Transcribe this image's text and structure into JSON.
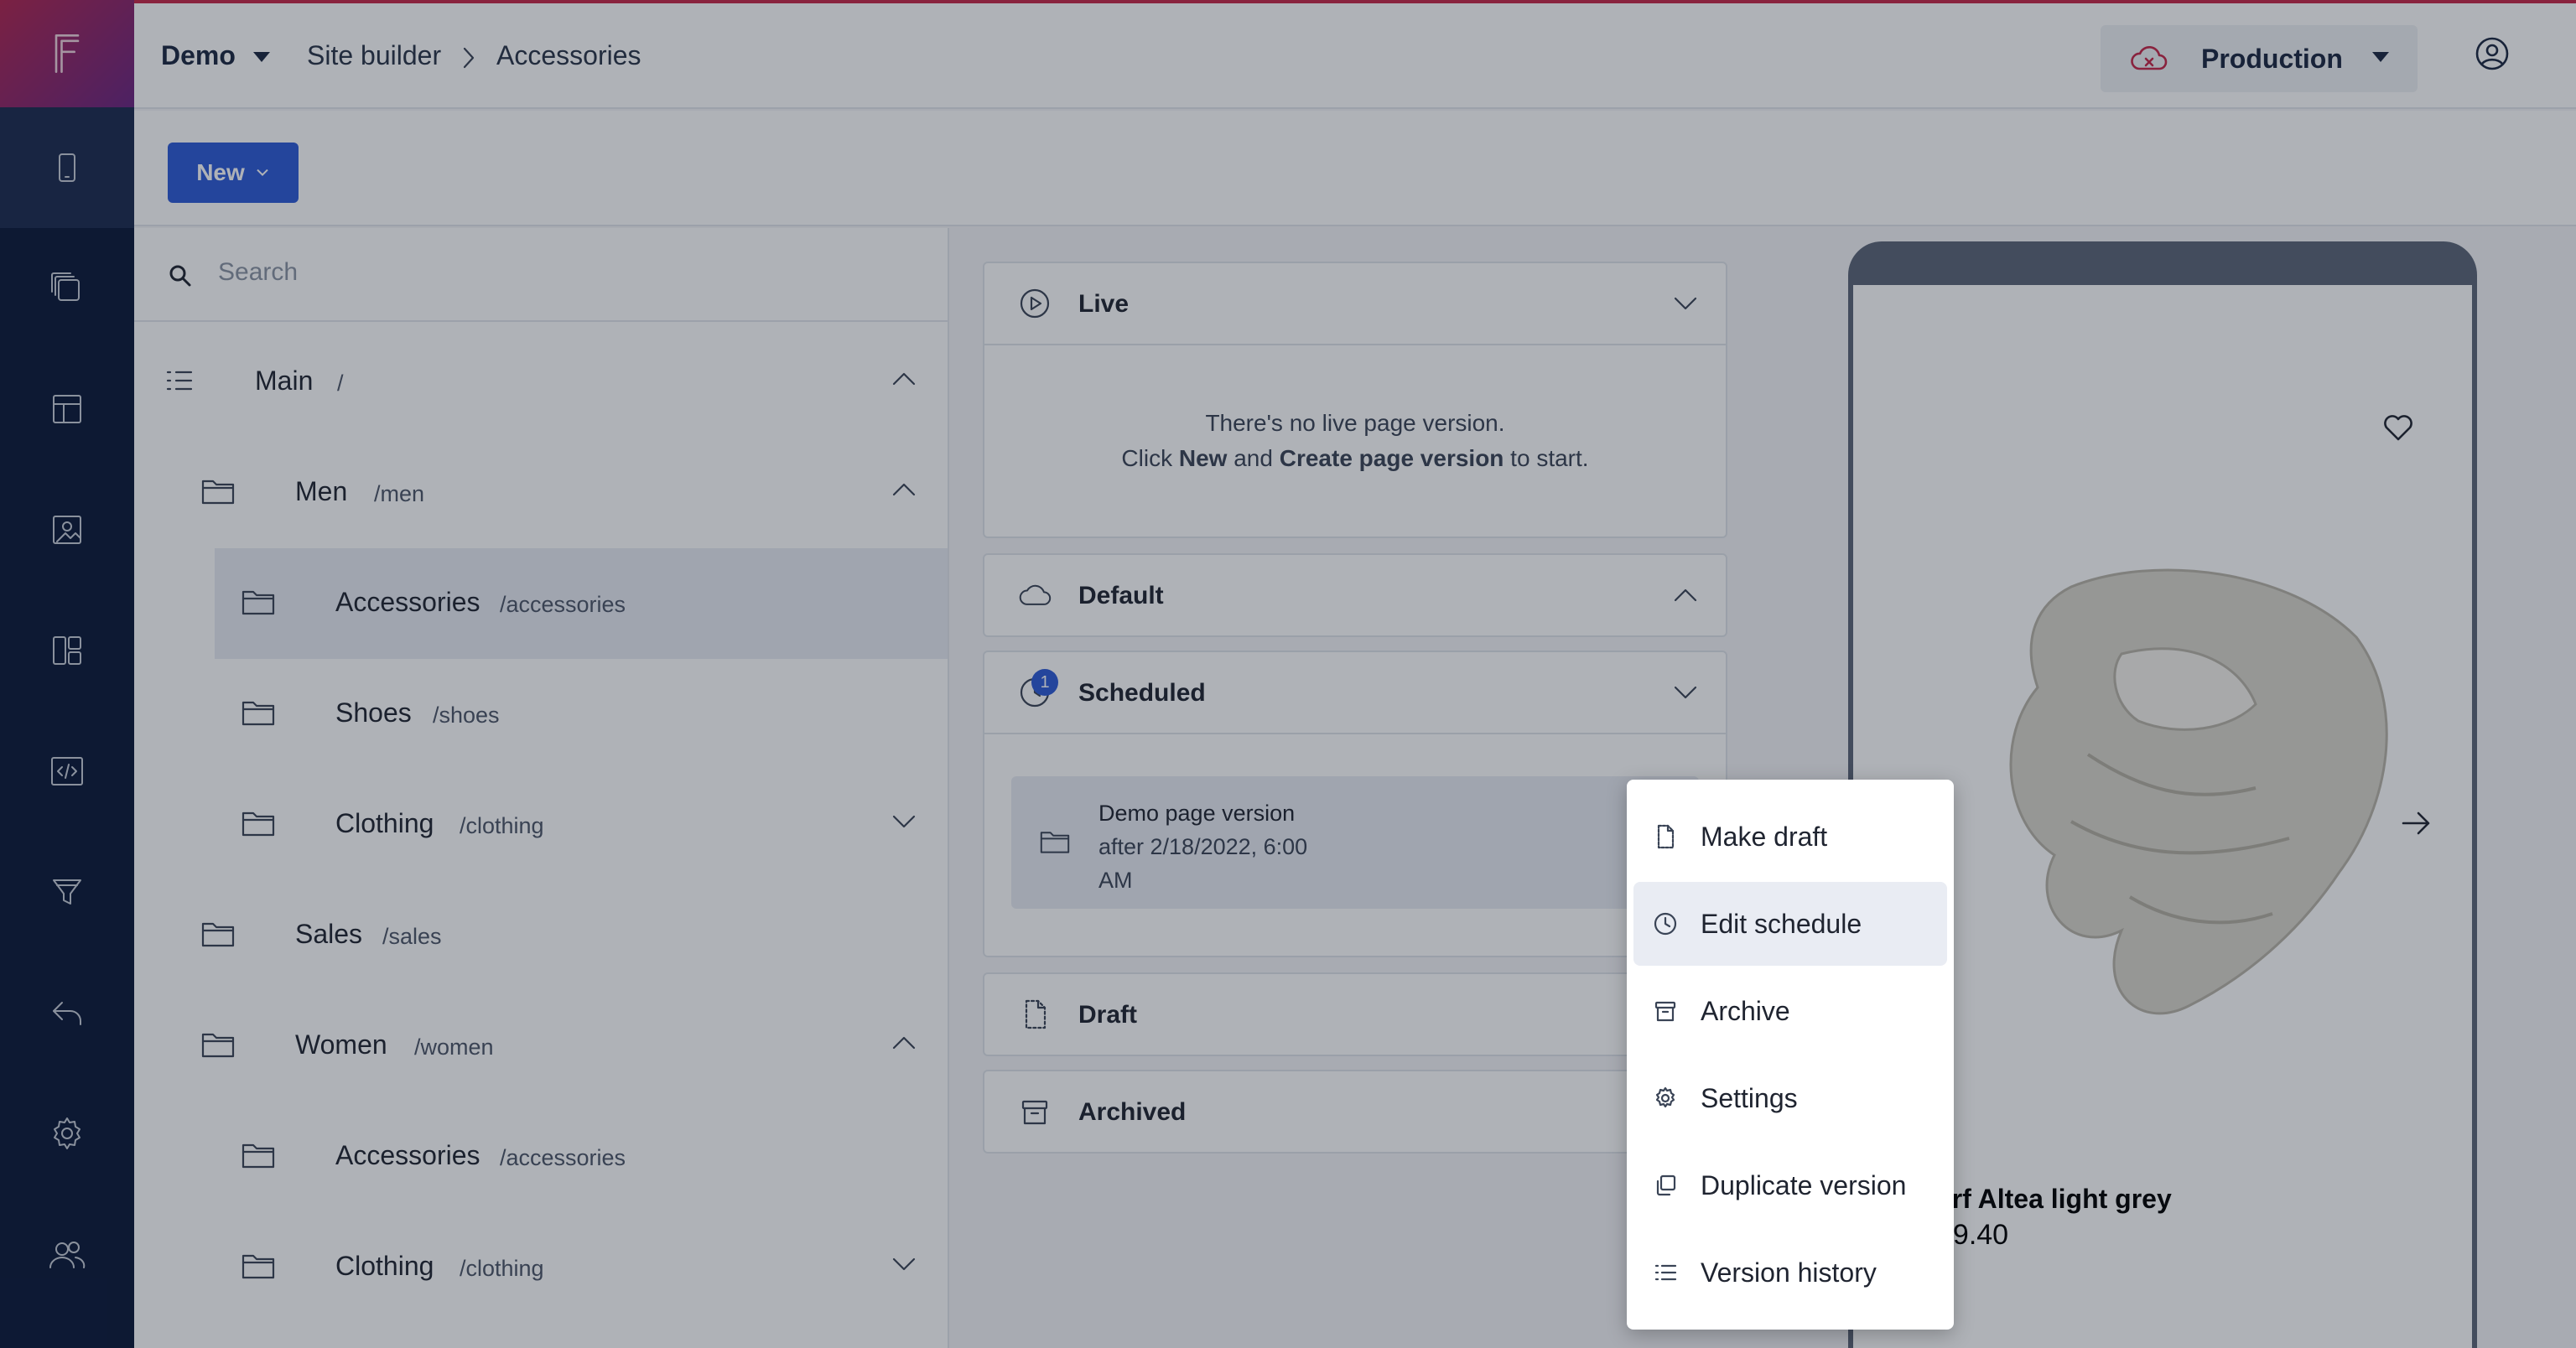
{
  "header": {
    "project": "Demo",
    "breadcrumb": [
      "Site builder",
      "Accessories"
    ],
    "environment": "Production"
  },
  "toolbar": {
    "new_label": "New"
  },
  "tree": {
    "search_placeholder": "Search",
    "rows": [
      {
        "name": "Main",
        "path": "/"
      },
      {
        "name": "Men",
        "path": "/men"
      },
      {
        "name": "Accessories",
        "path": "/accessories"
      },
      {
        "name": "Shoes",
        "path": "/shoes"
      },
      {
        "name": "Clothing",
        "path": "/clothing"
      },
      {
        "name": "Sales",
        "path": "/sales"
      },
      {
        "name": "Women",
        "path": "/women"
      },
      {
        "name": "Accessories",
        "path": "/accessories"
      },
      {
        "name": "Clothing",
        "path": "/clothing"
      }
    ]
  },
  "versions": {
    "live": {
      "title": "Live",
      "empty_line1": "There's no live page version.",
      "empty_pre": "Click ",
      "empty_new": "New",
      "empty_and": " and ",
      "empty_create": "Create page version",
      "empty_post": " to start."
    },
    "default": {
      "title": "Default"
    },
    "scheduled": {
      "title": "Scheduled",
      "count": "1",
      "item_title": "Demo page version",
      "item_subtitle": "after 2/18/2022, 6:00 AM"
    },
    "draft": {
      "title": "Draft"
    },
    "archived": {
      "title": "Archived"
    }
  },
  "preview": {
    "product_name": "arf Altea light grey",
    "product_price": "49.40"
  },
  "menu": {
    "items": [
      {
        "label": "Make draft",
        "icon": "draft-icon"
      },
      {
        "label": "Edit schedule",
        "icon": "clock-icon"
      },
      {
        "label": "Archive",
        "icon": "archive-icon"
      },
      {
        "label": "Settings",
        "icon": "gear-icon"
      },
      {
        "label": "Duplicate version",
        "icon": "duplicate-icon"
      },
      {
        "label": "Version history",
        "icon": "list-icon"
      }
    ]
  },
  "colors": {
    "rail": "#0a1838",
    "accent": "#2d5ad6",
    "brand": "#c52648"
  }
}
